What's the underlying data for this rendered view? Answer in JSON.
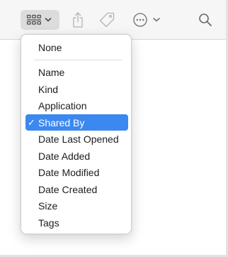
{
  "toolbar": {
    "buttons": [
      {
        "name": "group-button",
        "icon": "grid-icon"
      },
      {
        "name": "share-button",
        "icon": "share-icon"
      },
      {
        "name": "tag-button",
        "icon": "tag-icon"
      },
      {
        "name": "more-actions-button",
        "icon": "ellipsis-circle-icon"
      },
      {
        "name": "search-button",
        "icon": "search-icon"
      }
    ]
  },
  "menu": {
    "items": [
      {
        "label": "None",
        "checked": false
      },
      {
        "label": "Name",
        "checked": false
      },
      {
        "label": "Kind",
        "checked": false
      },
      {
        "label": "Application",
        "checked": false
      },
      {
        "label": "Shared By",
        "checked": true
      },
      {
        "label": "Date Last Opened",
        "checked": false
      },
      {
        "label": "Date Added",
        "checked": false
      },
      {
        "label": "Date Modified",
        "checked": false
      },
      {
        "label": "Date Created",
        "checked": false
      },
      {
        "label": "Size",
        "checked": false
      },
      {
        "label": "Tags",
        "checked": false
      }
    ],
    "check_glyph": "✓"
  },
  "colors": {
    "selection": "#3b88f0",
    "toolbar_bg": "#f6f6f6",
    "icon": "#8a8a8a"
  }
}
